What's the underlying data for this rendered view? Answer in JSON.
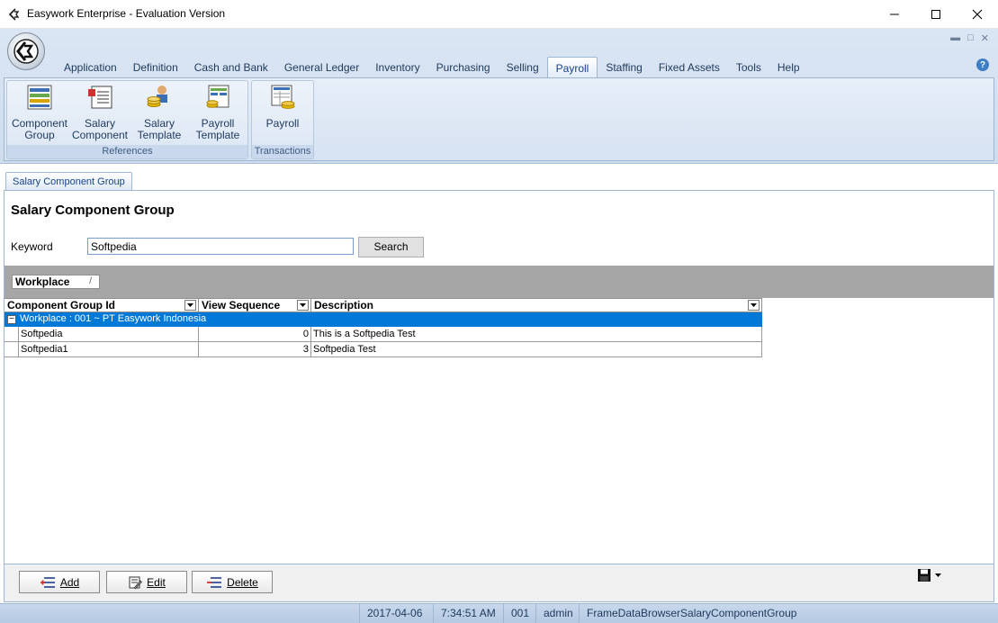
{
  "window": {
    "title": "Easywork Enterprise - Evaluation Version"
  },
  "menu": {
    "tabs": [
      {
        "label": "Application"
      },
      {
        "label": "Definition"
      },
      {
        "label": "Cash and Bank"
      },
      {
        "label": "General Ledger"
      },
      {
        "label": "Inventory"
      },
      {
        "label": "Purchasing"
      },
      {
        "label": "Selling"
      },
      {
        "label": "Payroll"
      },
      {
        "label": "Staffing"
      },
      {
        "label": "Fixed Assets"
      },
      {
        "label": "Tools"
      },
      {
        "label": "Help"
      }
    ],
    "active": "Payroll"
  },
  "ribbon": {
    "groups": [
      {
        "label": "References",
        "buttons": [
          {
            "line1": "Component",
            "line2": "Group",
            "icon": "component-group-icon"
          },
          {
            "line1": "Salary",
            "line2": "Component",
            "icon": "salary-component-icon"
          },
          {
            "line1": "Salary",
            "line2": "Template",
            "icon": "salary-template-icon"
          },
          {
            "line1": "Payroll",
            "line2": "Template",
            "icon": "payroll-template-icon"
          }
        ]
      },
      {
        "label": "Transactions",
        "buttons": [
          {
            "line1": "Payroll",
            "line2": "",
            "icon": "payroll-icon"
          }
        ]
      }
    ]
  },
  "doc_tab": {
    "label": "Salary Component Group"
  },
  "page": {
    "title": "Salary Component Group",
    "keyword_label": "Keyword",
    "keyword_value": "Softpedia",
    "search_label": "Search"
  },
  "grid": {
    "group_by_chip": "Workplace",
    "group_by_sort": "/",
    "columns": [
      {
        "label": "Component Group Id"
      },
      {
        "label": "View Sequence"
      },
      {
        "label": "Description"
      }
    ],
    "group_row": "Workplace : 001 ~ PT Easywork Indonesia",
    "group_toggle": "−",
    "rows": [
      {
        "id": "Softpedia",
        "sequence": "0",
        "description": "This is a Softpedia Test"
      },
      {
        "id": "Softpedia1",
        "sequence": "3",
        "description": "Softpedia Test"
      }
    ]
  },
  "actions": {
    "add": "Add",
    "edit": "Edit",
    "delete": "Delete"
  },
  "status": {
    "date": "2017-04-06",
    "time": "7:34:51 AM",
    "company": "001",
    "user": "admin",
    "frame": "FrameDataBrowserSalaryComponentGroup"
  },
  "colors": {
    "accent": "#0078d7",
    "ribbon": "#dbe6f4",
    "tab_text": "#15428b"
  }
}
